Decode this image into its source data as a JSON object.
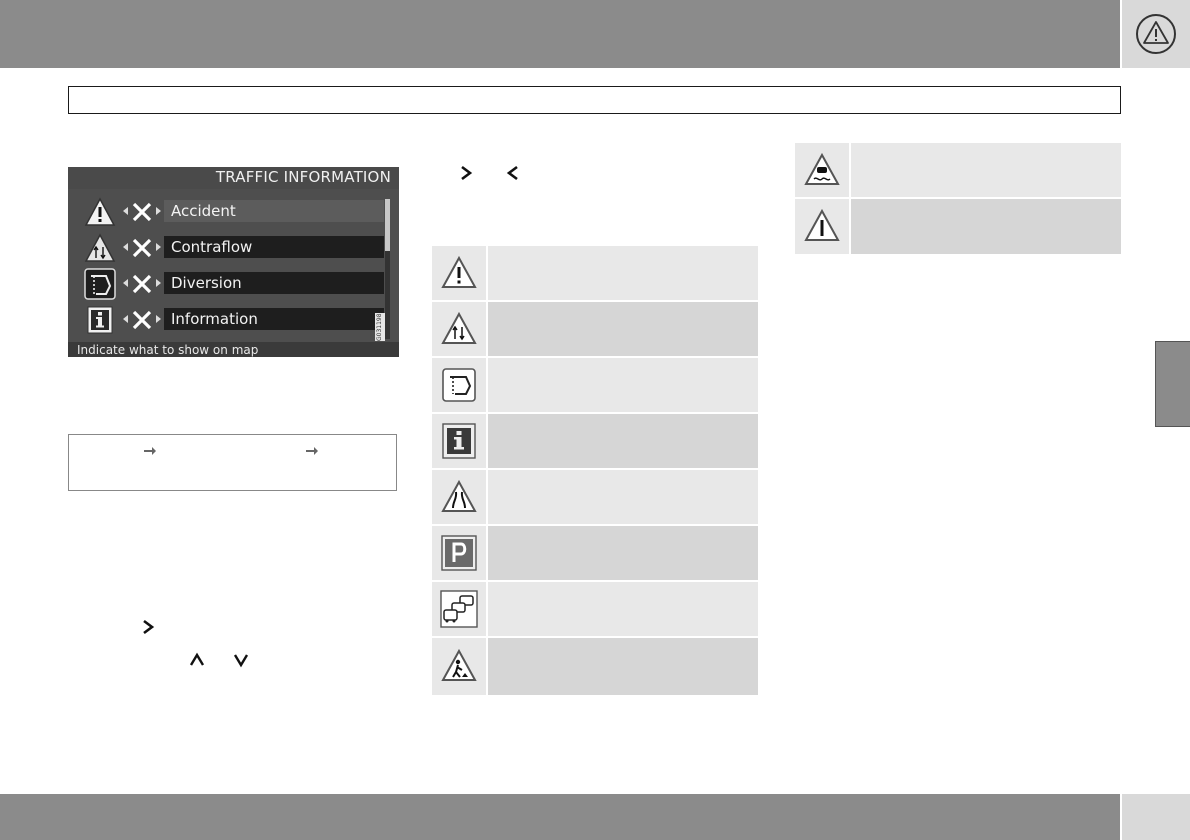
{
  "header": {
    "warning_icon": "warning-triangle-icon",
    "bar_color": "#8b8b8b"
  },
  "screen": {
    "title": "TRAFFIC INFORMATION",
    "rows": [
      {
        "label": "Accident",
        "icon": "warning-triangle-icon",
        "selected": true
      },
      {
        "label": "Contraflow",
        "icon": "contraflow-icon",
        "selected": false
      },
      {
        "label": "Diversion",
        "icon": "diversion-icon",
        "selected": false
      },
      {
        "label": "Information",
        "icon": "information-icon",
        "selected": false
      }
    ],
    "hint": "Indicate what to show on map",
    "code": "G031198"
  },
  "symbols_table": {
    "icons": [
      "warning-triangle-icon",
      "contraflow-icon",
      "diversion-icon",
      "information-icon",
      "road-narrows-icon",
      "parking-icon",
      "traffic-queue-icon",
      "roadworks-icon"
    ]
  },
  "symbols_table_right": {
    "icons": [
      "slippery-road-icon",
      "general-danger-icon"
    ]
  },
  "colors": {
    "cell_light": "#e8e8e8",
    "cell_dark": "#d6d6d6"
  }
}
